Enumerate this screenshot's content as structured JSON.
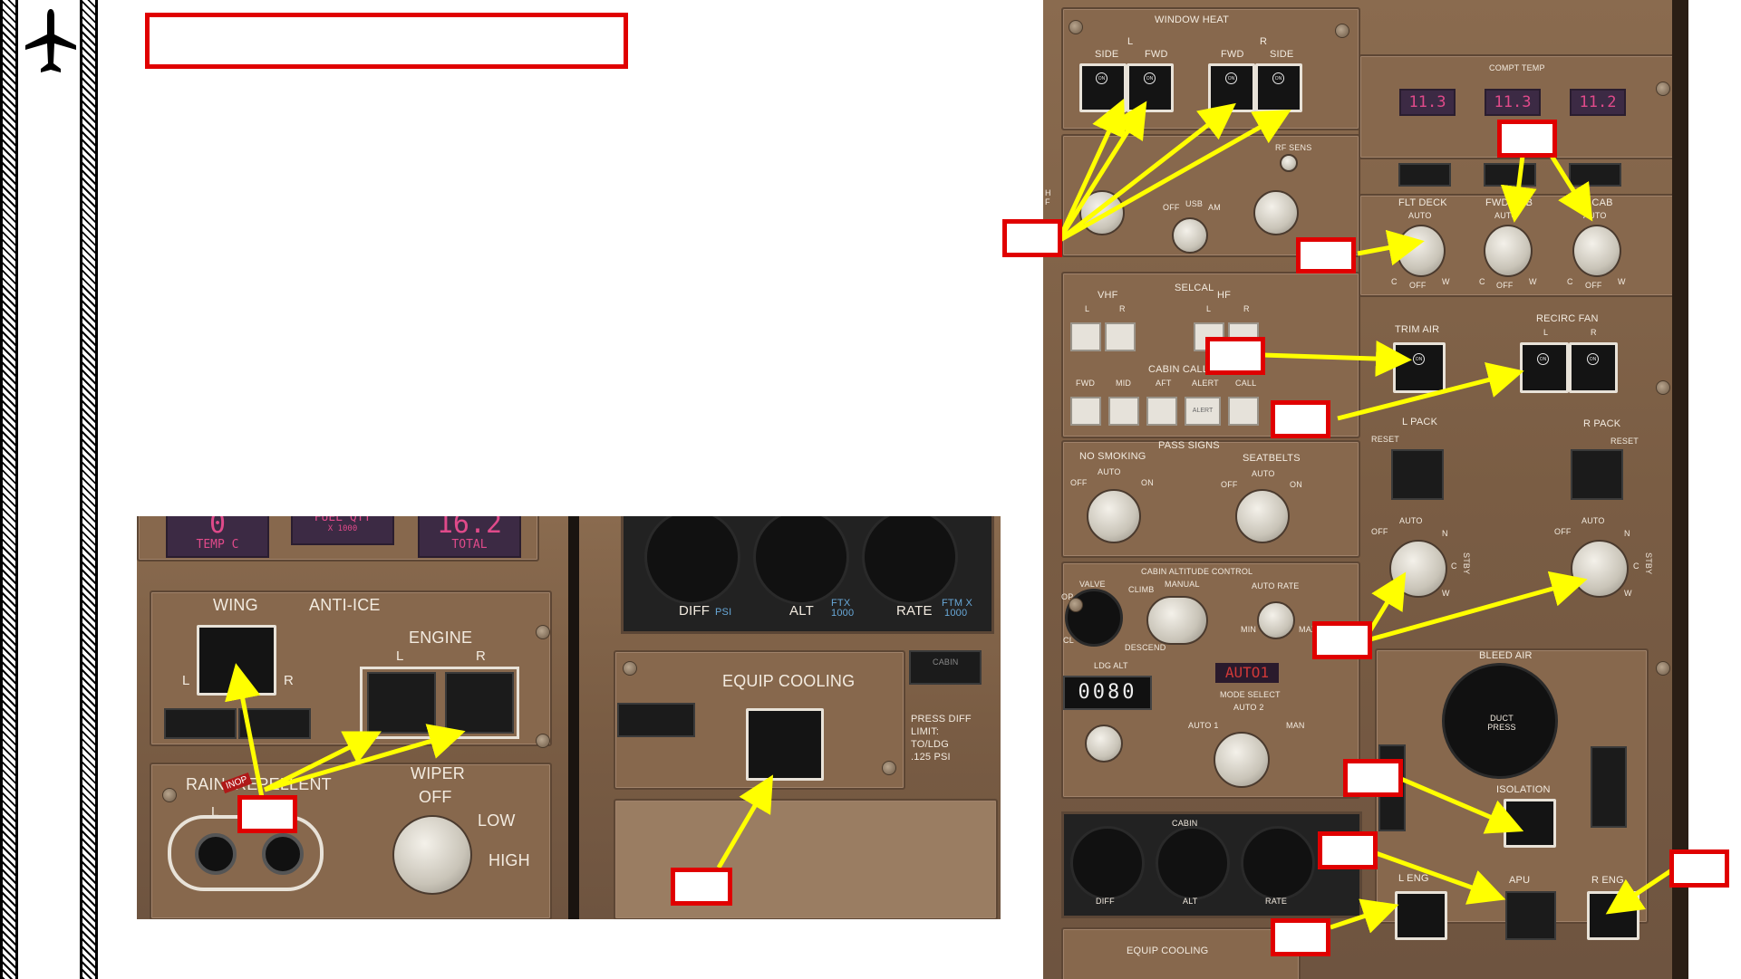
{
  "left_panel": {
    "temp": {
      "value": "0",
      "label": "TEMP C"
    },
    "fuel": {
      "label": "FUEL QTY",
      "sub": "X 1000"
    },
    "total": {
      "value": "16.2",
      "label": "TOTAL"
    },
    "wing": "WING",
    "anti_ice": "ANTI-ICE",
    "engine": "ENGINE",
    "l": "L",
    "r": "R",
    "rain": "RAIN",
    "repellent": "REPELLENT",
    "inop": "INOP",
    "wiper": "WIPER",
    "wiper_off": "OFF",
    "wiper_low": "LOW",
    "wiper_high": "HIGH",
    "diff": "DIFF",
    "psi": "PSI",
    "alt": "ALT",
    "ftx": "FTX",
    "thousand": "1000",
    "rate": "RATE",
    "ftm": "FTM X",
    "equip_cooling": "EQUIP COOLING",
    "cabin_alt": "CABIN",
    "press_diff": "PRESS DIFF",
    "limit": "LIMIT:",
    "to_ldg": "TO/LDG",
    "psi_125": ".125 PSI"
  },
  "right_panel": {
    "window_heat": "WINDOW HEAT",
    "l": "L",
    "r": "R",
    "side": "SIDE",
    "fwd": "FWD",
    "on": "ON",
    "rf_sens": "RF SENS",
    "off": "OFF",
    "usb": "USB",
    "am": "AM",
    "hf": "H F",
    "compt_temp": "COMPT TEMP",
    "temp_values": [
      "11.3",
      "11.3",
      "11.2"
    ],
    "flt_deck": "FLT DECK",
    "fwd_cab": "FWD CAB",
    "aft_cab": "AFT CAB",
    "auto": "AUTO",
    "c": "C",
    "w": "W",
    "vhf": "VHF",
    "selcal": "SELCAL",
    "hf_lbl": "HF",
    "cabin_call": "CABIN CALL",
    "cc_fwd": "FWD",
    "cc_mid": "MID",
    "cc_aft": "AFT",
    "cc_alert": "ALERT",
    "cc_call": "CALL",
    "alert_btn": "ALERT",
    "trim_air": "TRIM AIR",
    "recirc_fan": "RECIRC FAN",
    "pass_signs": "PASS SIGNS",
    "no_smoking": "NO SMOKING",
    "seatbelts": "SEATBELTS",
    "l_pack": "L PACK",
    "r_pack": "R PACK",
    "reset": "RESET",
    "n": "N",
    "stby": "STBY",
    "cabin_alt_control": "CABIN ALTITUDE CONTROL",
    "valve": "VALVE",
    "op": "OP",
    "cl": "CL",
    "climb": "CLIMB",
    "descend": "DESCEND",
    "manual": "MANUAL",
    "auto_rate": "AUTO RATE",
    "min": "MIN",
    "max": "MAX",
    "ldg_alt": "LDG ALT",
    "ldg_alt_value": "0080",
    "auto1_badge": "AUTO1",
    "mode_select": "MODE SELECT",
    "auto2": "AUTO 2",
    "auto1": "AUTO 1",
    "man": "MAN",
    "bleed_air": "BLEED AIR",
    "duct_press": "DUCT PRESS",
    "isolation": "ISOLATION",
    "l_eng": "L ENG",
    "apu": "APU",
    "r_eng": "R ENG",
    "cabin": "CABIN",
    "diff": "DIFF",
    "alt": "ALT",
    "rate": "RATE",
    "equip_cooling": "EQUIP COOLING"
  }
}
